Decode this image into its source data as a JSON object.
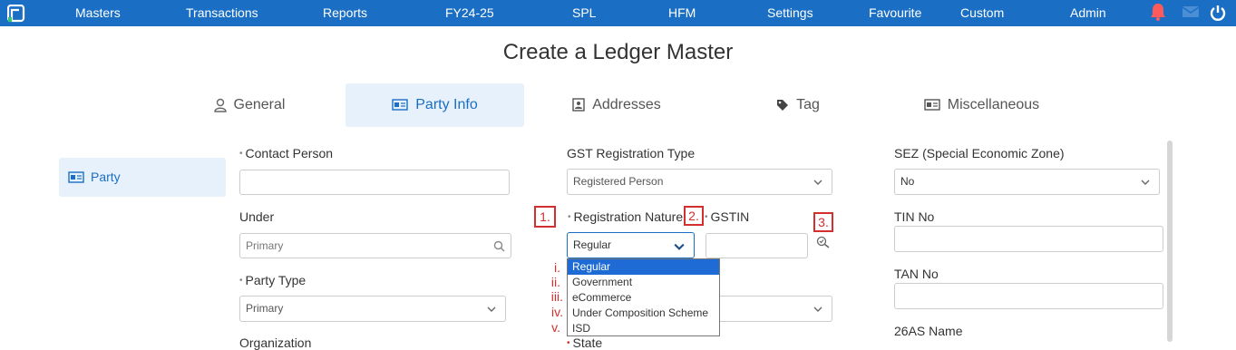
{
  "nav": {
    "items": [
      "Masters",
      "Transactions",
      "Reports",
      "FY24-25",
      "SPL",
      "HFM",
      "Settings",
      "Favourite",
      "Custom",
      "Admin"
    ],
    "icons": [
      "bell-icon",
      "message-icon",
      "power-icon"
    ],
    "accent": "#1a6fc4"
  },
  "page": {
    "title": "Create a Ledger Master"
  },
  "tabs": [
    "General",
    "Party Info",
    "Addresses",
    "Tag",
    "Miscellaneous"
  ],
  "sidebar": {
    "items": [
      {
        "label": "Party"
      }
    ]
  },
  "form": {
    "contact_person": {
      "label": "Contact Person",
      "value": ""
    },
    "under": {
      "label": "Under",
      "placeholder": "Primary"
    },
    "party_type": {
      "label": "Party Type",
      "value": "Primary"
    },
    "organization": {
      "label": "Organization"
    },
    "gst_reg_type": {
      "label": "GST Registration Type",
      "value": "Registered Person"
    },
    "registration_nature": {
      "label": "Registration Nature",
      "value": "Regular",
      "options": [
        "Regular",
        "Government",
        "eCommerce",
        "Under Composition Scheme",
        "ISD"
      ]
    },
    "gstin": {
      "label": "GSTIN",
      "value": ""
    },
    "state": {
      "label": "State"
    },
    "sez": {
      "label": "SEZ (Special Economic Zone)",
      "value": "No"
    },
    "tin_no": {
      "label": "TIN No",
      "value": ""
    },
    "tan_no": {
      "label": "TAN No",
      "value": ""
    },
    "name_26as": {
      "label": "26AS Name"
    }
  },
  "annotations": {
    "numbers": [
      "1.",
      "2.",
      "3."
    ],
    "romans": [
      "i.",
      "ii.",
      "iii.",
      "iv.",
      "v."
    ]
  }
}
